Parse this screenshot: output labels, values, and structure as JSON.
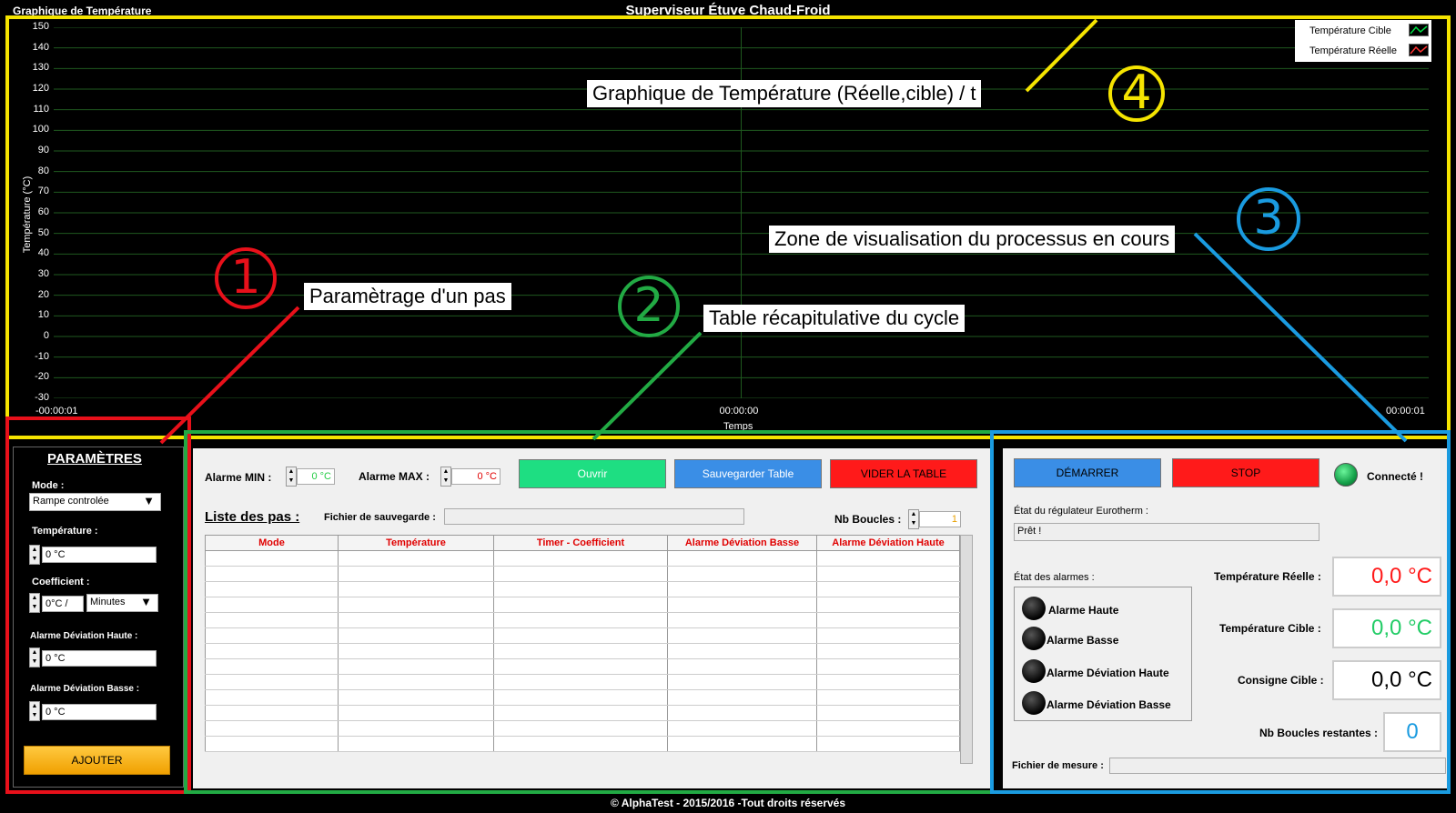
{
  "window": {
    "title": "Superviseur Étuve Chaud-Froid",
    "chart_caption": "Graphique de Température",
    "footer": "© AlphaTest - 2015/2016 -Tout droits réservés"
  },
  "annotations": {
    "graph": "Graphique de Température (Réelle,cible) / t",
    "process": "Zone de visualisation du processus en cours",
    "params": "Paramètrage d'un pas",
    "table": "Table récapitulative du cycle",
    "n1": "1",
    "n2": "2",
    "n3": "3",
    "n4": "4"
  },
  "colors": {
    "red": "#e8101a",
    "green": "#22aa44",
    "blue": "#1a9be0",
    "yellow": "#f5e400"
  },
  "chart_data": {
    "type": "line",
    "ylabel": "Température (°C)",
    "xlabel": "Temps",
    "ylim": [
      -30,
      150
    ],
    "y_ticks": [
      "150",
      "140",
      "130",
      "120",
      "110",
      "100",
      "90",
      "80",
      "70",
      "60",
      "50",
      "40",
      "30",
      "20",
      "10",
      "0",
      "-10",
      "-20",
      "-30"
    ],
    "x_ticks": [
      "-00:00:01",
      "00:00:00",
      "00:00:01"
    ],
    "grid": true,
    "legend_position": "top-right",
    "series": [
      {
        "name": "Température Cible",
        "color": "#00dd44",
        "values": []
      },
      {
        "name": "Température Réelle",
        "color": "#ff3333",
        "values": []
      }
    ]
  },
  "params": {
    "title": "PARAMÈTRES",
    "mode_label": "Mode :",
    "mode_value": "Rampe controlée",
    "temp_label": "Température :",
    "temp_value": "0 °C",
    "coef_label": "Coefficient :",
    "coef_value": "0°C /",
    "coef_unit": "Minutes",
    "dev_high_label": "Alarme Déviation Haute :",
    "dev_high_value": "0 °C",
    "dev_low_label": "Alarme Déviation Basse :",
    "dev_low_value": "0 °C",
    "add_button": "AJOUTER"
  },
  "table_panel": {
    "alarm_min_label": "Alarme  MIN :",
    "alarm_min_value": "0 °C",
    "alarm_max_label": "Alarme MAX :",
    "alarm_max_value": "0 °C",
    "open_button": "Ouvrir",
    "save_button": "Sauvegarder Table",
    "clear_button": "VIDER LA TABLE",
    "list_title": "Liste des pas :",
    "file_label": "Fichier de sauvegarde :",
    "file_value": "",
    "loops_label": "Nb Boucles :",
    "loops_value": "1",
    "columns": [
      "Mode",
      "Température",
      "Timer - Coefficient",
      "Alarme Déviation Basse",
      "Alarme Déviation Haute"
    ]
  },
  "process": {
    "start_button": "DÉMARRER",
    "stop_button": "STOP",
    "connected_label": "Connecté !",
    "regulator_label": "État du régulateur Eurotherm :",
    "regulator_value": "Prêt !",
    "alarms_label": "État des alarmes :",
    "alarms": [
      "Alarme Haute",
      "Alarme Basse",
      "Alarme Déviation Haute",
      "Alarme Déviation Basse"
    ],
    "temp_real_label": "Température Réelle :",
    "temp_real_value": "0,0 °C",
    "temp_target_label": "Température Cible :",
    "temp_target_value": "0,0 °C",
    "setpoint_label": "Consigne Cible :",
    "setpoint_value": "0,0 °C",
    "loops_left_label": "Nb Boucles restantes :",
    "loops_left_value": "0",
    "measure_file_label": "Fichier de mesure :"
  }
}
